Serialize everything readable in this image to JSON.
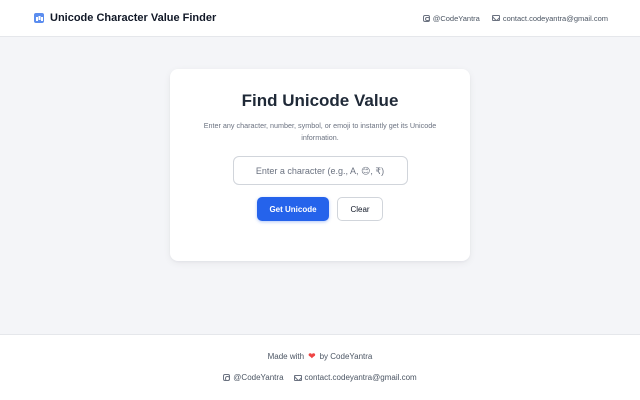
{
  "header": {
    "title": "Unicode Character Value Finder",
    "brand_icon": "bar-chart-icon",
    "instagram": "@CodeYantra",
    "email": "contact.codeyantra@gmail.com"
  },
  "card": {
    "title": "Find Unicode Value",
    "description": "Enter any character, number, symbol, or emoji to instantly get its Unicode information.",
    "input_placeholder": "Enter a character (e.g., A, 😊, ₹)",
    "input_value": "",
    "primary_button": "Get Unicode",
    "secondary_button": "Clear"
  },
  "footer": {
    "made_with_prefix": "Made with",
    "heart": "❤",
    "made_with_suffix": "by CodeYantra",
    "instagram": "@CodeYantra",
    "email": "contact.codeyantra@gmail.com"
  },
  "colors": {
    "accent": "#2563eb",
    "heart": "#ef4444",
    "page_background": "#f4f5f8"
  }
}
